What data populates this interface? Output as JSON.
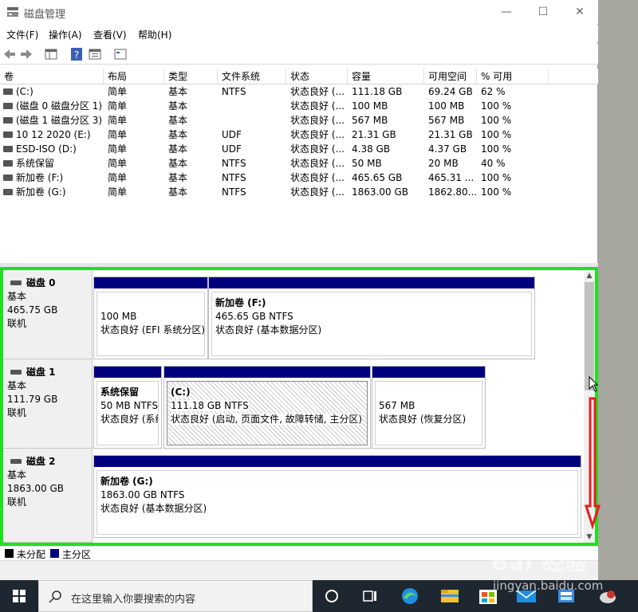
{
  "window": {
    "title": "磁盘管理",
    "minimize": "—",
    "maximize": "☐",
    "close": "✕"
  },
  "menu": [
    "文件(F)",
    "操作(A)",
    "查看(V)",
    "帮助(H)"
  ],
  "volume_table": {
    "columns": [
      "卷",
      "布局",
      "类型",
      "文件系统",
      "状态",
      "容量",
      "可用空间",
      "% 可用"
    ],
    "rows": [
      [
        "(C:)",
        "简单",
        "基本",
        "NTFS",
        "状态良好 (...",
        "111.18 GB",
        "69.24 GB",
        "62 %"
      ],
      [
        "(磁盘 0 磁盘分区 1)",
        "简单",
        "基本",
        "",
        "状态良好 (...",
        "100 MB",
        "100 MB",
        "100 %"
      ],
      [
        "(磁盘 1 磁盘分区 3)",
        "简单",
        "基本",
        "",
        "状态良好 (...",
        "567 MB",
        "567 MB",
        "100 %"
      ],
      [
        "10 12 2020 (E:)",
        "简单",
        "基本",
        "UDF",
        "状态良好 (...",
        "21.31 GB",
        "21.31 GB",
        "100 %"
      ],
      [
        "ESD-ISO (D:)",
        "简单",
        "基本",
        "UDF",
        "状态良好 (...",
        "4.38 GB",
        "4.37 GB",
        "100 %"
      ],
      [
        "系统保留",
        "简单",
        "基本",
        "NTFS",
        "状态良好 (...",
        "50 MB",
        "20 MB",
        "40 %"
      ],
      [
        "新加卷 (F:)",
        "简单",
        "基本",
        "NTFS",
        "状态良好 (...",
        "465.65 GB",
        "465.31 ...",
        "100 %"
      ],
      [
        "新加卷 (G:)",
        "简单",
        "基本",
        "NTFS",
        "状态良好 (...",
        "1863.00 GB",
        "1862.80...",
        "100 %"
      ]
    ]
  },
  "disks": [
    {
      "name": "磁盘 0",
      "type": "基本",
      "size": "465.75 GB",
      "status": "联机",
      "partitions": [
        {
          "name": "",
          "size": "100 MB",
          "status": "状态良好 (EFI 系统分区)"
        },
        {
          "name": "新加卷  (F:)",
          "size": "465.65 GB NTFS",
          "status": "状态良好 (基本数据分区)"
        }
      ]
    },
    {
      "name": "磁盘 1",
      "type": "基本",
      "size": "111.79 GB",
      "status": "联机",
      "partitions": [
        {
          "name": "系统保留",
          "size": "50 MB NTFS",
          "status": "状态良好 (系统"
        },
        {
          "name": "(C:)",
          "size": "111.18 GB NTFS",
          "status": "状态良好 (启动, 页面文件, 故障转储, 主分区)"
        },
        {
          "name": "",
          "size": "567 MB",
          "status": "状态良好 (恢复分区)"
        }
      ]
    },
    {
      "name": "磁盘 2",
      "type": "基本",
      "size": "1863.00 GB",
      "status": "联机",
      "partitions": [
        {
          "name": "新加卷  (G:)",
          "size": "1863.00 GB NTFS",
          "status": "状态良好 (基本数据分区)"
        }
      ]
    }
  ],
  "legend": {
    "unallocated": "未分配",
    "primary": "主分区"
  },
  "colors": {
    "primary_partition": "#00007f",
    "unallocated": "#000000",
    "highlight_frame": "#1ee11e",
    "annotation_arrow": "#e81e1e"
  },
  "taskbar": {
    "search_placeholder": "在这里输入你要搜索的内容"
  },
  "watermark": {
    "logo": "Bai 经验",
    "url": "jingyan.baidu.com"
  }
}
